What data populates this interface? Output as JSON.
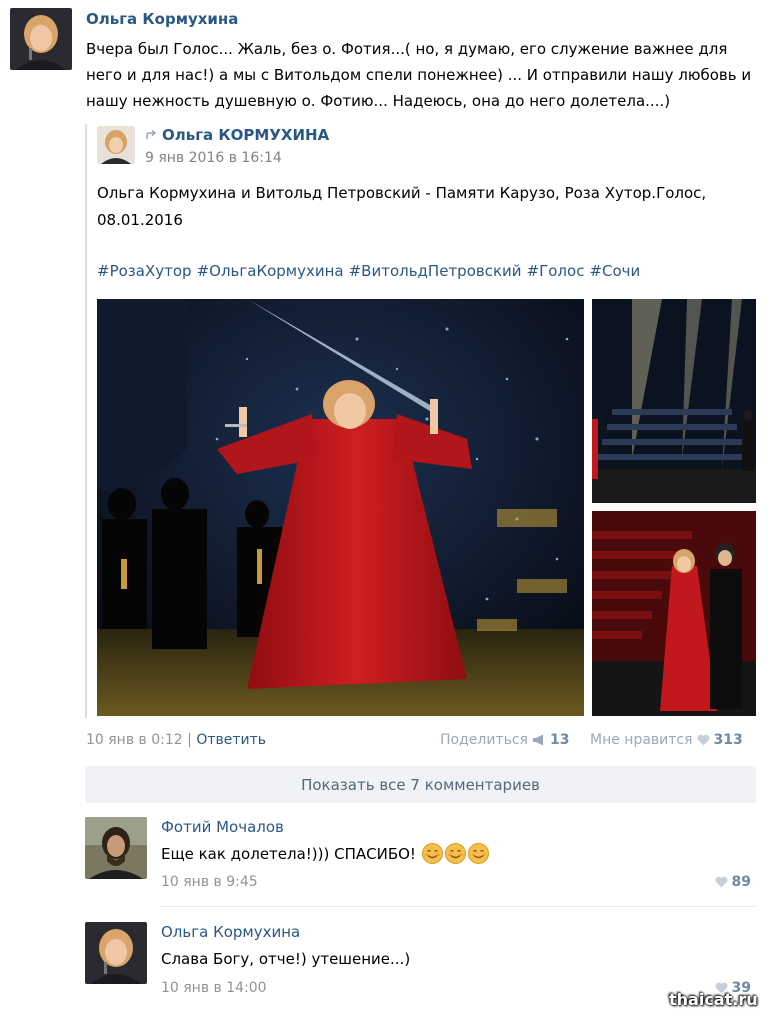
{
  "post": {
    "author": "Ольга Кормухина",
    "text": "Вчера был Голос... Жаль, без о. Фотия...( но, я думаю, его служение важнее для него и для нас!) а мы с Витольдом спели понежнее) ... И отправили нашу любовь и нашу нежность душевную о. Фотию... Надеюсь, она до него долетела....)",
    "repost": {
      "author": "Ольга КОРМУХИНА",
      "date": "9 янв 2016 в 16:14",
      "text": "Ольга Кормухина и Витольд Петровский - Памяти Карузо, Роза Хутор.Голос, 08.01.2016",
      "hashtags": [
        "#РозаХутор",
        "#ОльгаКормухина",
        "#ВитольдПетровский",
        "#Голос",
        "#Сочи"
      ]
    },
    "time": "10 янв в 0:12",
    "separator": "|",
    "reply_label": "Ответить",
    "share_label": "Поделиться",
    "share_count": "13",
    "like_label": "Мне нравится",
    "like_count": "313"
  },
  "show_all_comments": "Показать все 7 комментариев",
  "comments": [
    {
      "author": "Фотий Мочалов",
      "text": "Еще как долетела!))) СПАСИБО!",
      "date": "10 янв в 9:45",
      "likes": "89",
      "emoji_count": 3
    },
    {
      "author": "Ольга Кормухина",
      "text": "Слава Богу, отче!) утешение...)",
      "date": "10 янв в 14:00",
      "likes": "39"
    }
  ],
  "watermark": "thaicat.ru",
  "colors": {
    "link": "#2a5885",
    "muted": "#939393",
    "action": "#99a9bb",
    "dress_red": "#c0181c",
    "stage_dark": "#0c1424"
  }
}
